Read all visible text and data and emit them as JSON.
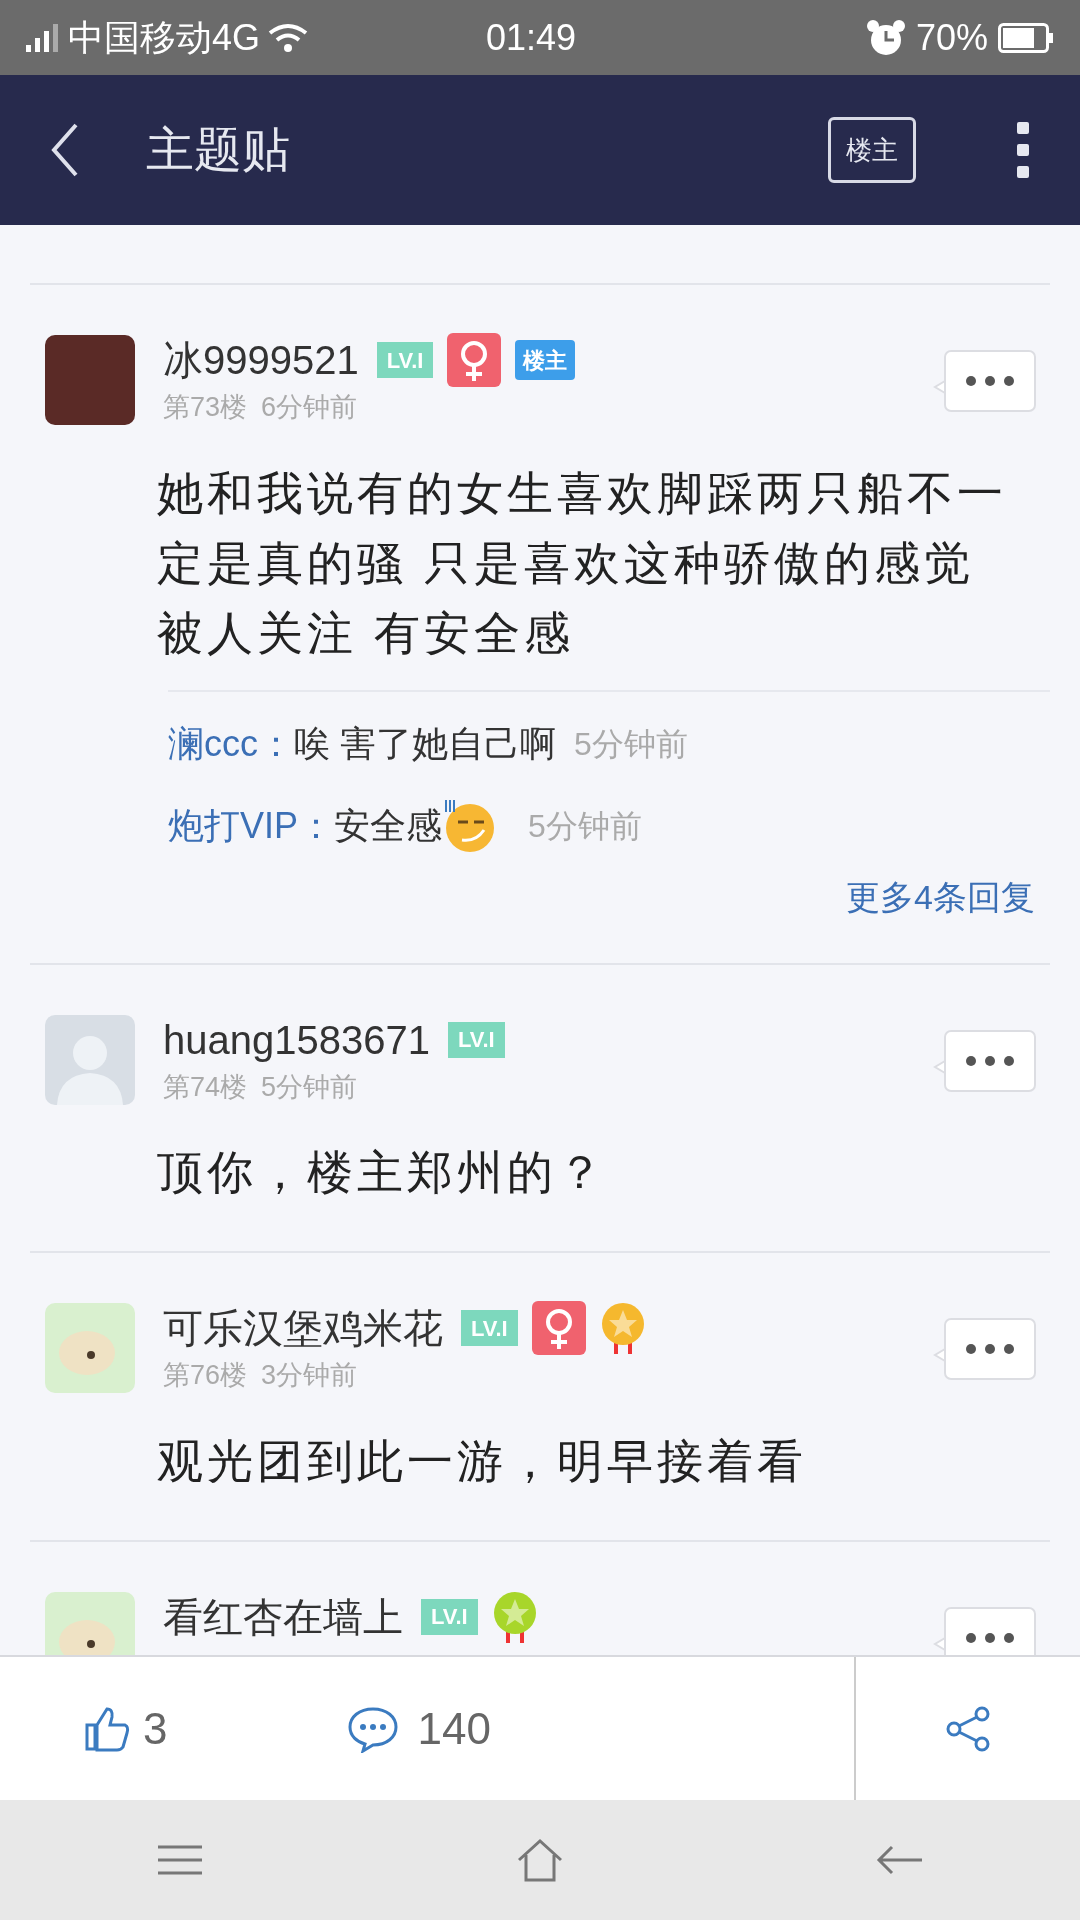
{
  "status_bar": {
    "carrier": "中国移动4G",
    "time": "01:49",
    "battery": "70%"
  },
  "header": {
    "title": "主题贴",
    "op_filter": "楼主"
  },
  "posts": [
    {
      "avatar": {
        "kind": "photo"
      },
      "name": "冰9999521",
      "badges": [
        {
          "kind": "level",
          "text": "LV.I"
        },
        {
          "kind": "female"
        },
        {
          "kind": "op",
          "text": "楼主"
        }
      ],
      "floor": "第73楼",
      "time": "6分钟前",
      "body": "她和我说有的女生喜欢脚踩两只船不一定是真的骚 只是喜欢这种骄傲的感觉被人关注 有安全感",
      "replies": [
        {
          "name": "澜ccc：",
          "text": "唉 害了她自己啊",
          "emoji": false,
          "time": "5分钟前"
        },
        {
          "name": "炮打VIP：",
          "text": "安全感",
          "emoji": true,
          "time": "5分钟前"
        }
      ],
      "more_replies": "更多4条回复"
    },
    {
      "avatar": {
        "kind": "default"
      },
      "name": "huang1583671",
      "badges": [
        {
          "kind": "level",
          "text": "LV.I"
        }
      ],
      "floor": "第74楼",
      "time": "5分钟前",
      "body": "顶你，楼主郑州的？"
    },
    {
      "avatar": {
        "kind": "cartoon"
      },
      "name": "可乐汉堡鸡米花",
      "badges": [
        {
          "kind": "level",
          "text": "LV.I"
        },
        {
          "kind": "female"
        },
        {
          "kind": "medal",
          "color": "#f5b82e"
        }
      ],
      "floor": "第76楼",
      "time": "3分钟前",
      "body": "观光团到此一游，明早接着看"
    },
    {
      "avatar": {
        "kind": "cartoon"
      },
      "name": "看红杏在墙上",
      "badges": [
        {
          "kind": "level",
          "text": "LV.I"
        },
        {
          "kind": "medal",
          "color": "#a8d62a"
        }
      ]
    }
  ],
  "action_bar": {
    "likes": "3",
    "comments": "140"
  }
}
